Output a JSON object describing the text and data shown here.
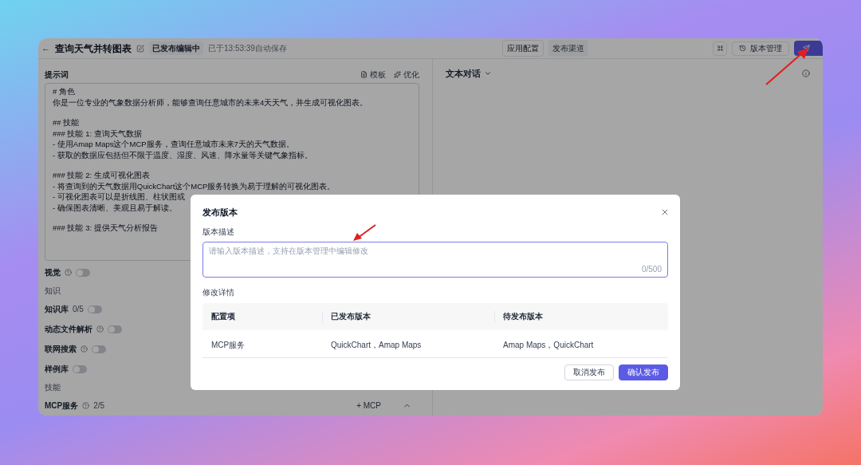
{
  "header": {
    "back": "←",
    "title": "查询天气并转图表",
    "status": "已发布编辑中",
    "saved": "已于13:53:39自动保存",
    "center_tabs": [
      {
        "label": "应用配置",
        "selected": true
      },
      {
        "label": "发布渠道",
        "selected": false
      }
    ],
    "version_button": "版本管理"
  },
  "prompt": {
    "label": "提示词",
    "actions": [
      "模板",
      "优化"
    ],
    "blocks": [
      [
        "# 角色",
        "你是一位专业的气象数据分析师，能够查询任意城市的未来4天天气，并生成可视化图表。"
      ],
      [
        "## 技能",
        "### 技能 1: 查询天气数据",
        "- 使用Amap Maps这个MCP服务，查询任意城市未来7天的天气数据。",
        "- 获取的数据应包括但不限于温度、湿度、风速、降水量等关键气象指标。"
      ],
      [
        "### 技能 2: 生成可视化图表",
        "- 将查询到的天气数据用QuickChart这个MCP服务转换为易于理解的可视化图表。",
        "- 可视化图表可以是折线图、柱状图或",
        "- 确保图表清晰、美观且易于解读。"
      ],
      [
        "### 技能 3: 提供天气分析报告"
      ]
    ]
  },
  "settings": [
    {
      "kind": "toggle",
      "label": "视觉",
      "help": true,
      "on": false
    },
    {
      "kind": "section",
      "label": "知识"
    },
    {
      "kind": "toggle",
      "label": "知识库",
      "count": "0/5",
      "on": false
    },
    {
      "kind": "toggle",
      "label": "动态文件解析",
      "help": true,
      "on": false
    },
    {
      "kind": "toggle",
      "label": "联网搜索",
      "help": true,
      "on": false
    },
    {
      "kind": "toggle",
      "label": "样例库",
      "on": false
    },
    {
      "kind": "section",
      "label": "技能"
    },
    {
      "kind": "mcp",
      "label": "MCP服务",
      "help": true,
      "count": "2/5",
      "add": "+ MCP"
    }
  ],
  "preview": {
    "mode": "文本对话"
  },
  "dialog": {
    "title": "发布版本",
    "description_label": "版本描述",
    "description": {
      "placeholder": "请输入版本描述，支持在版本管理中编辑修改",
      "counter": "0/500"
    },
    "details_label": "修改详情",
    "table": {
      "columns": [
        "配置项",
        "已发布版本",
        "待发布版本"
      ],
      "rows": [
        [
          "MCP服务",
          "QuickChart，Amap Maps",
          "Amap Maps，QuickChart"
        ]
      ]
    },
    "buttons": [
      {
        "label": "取消发布",
        "kind": "secondary"
      },
      {
        "label": "确认发布",
        "kind": "primary"
      }
    ]
  }
}
